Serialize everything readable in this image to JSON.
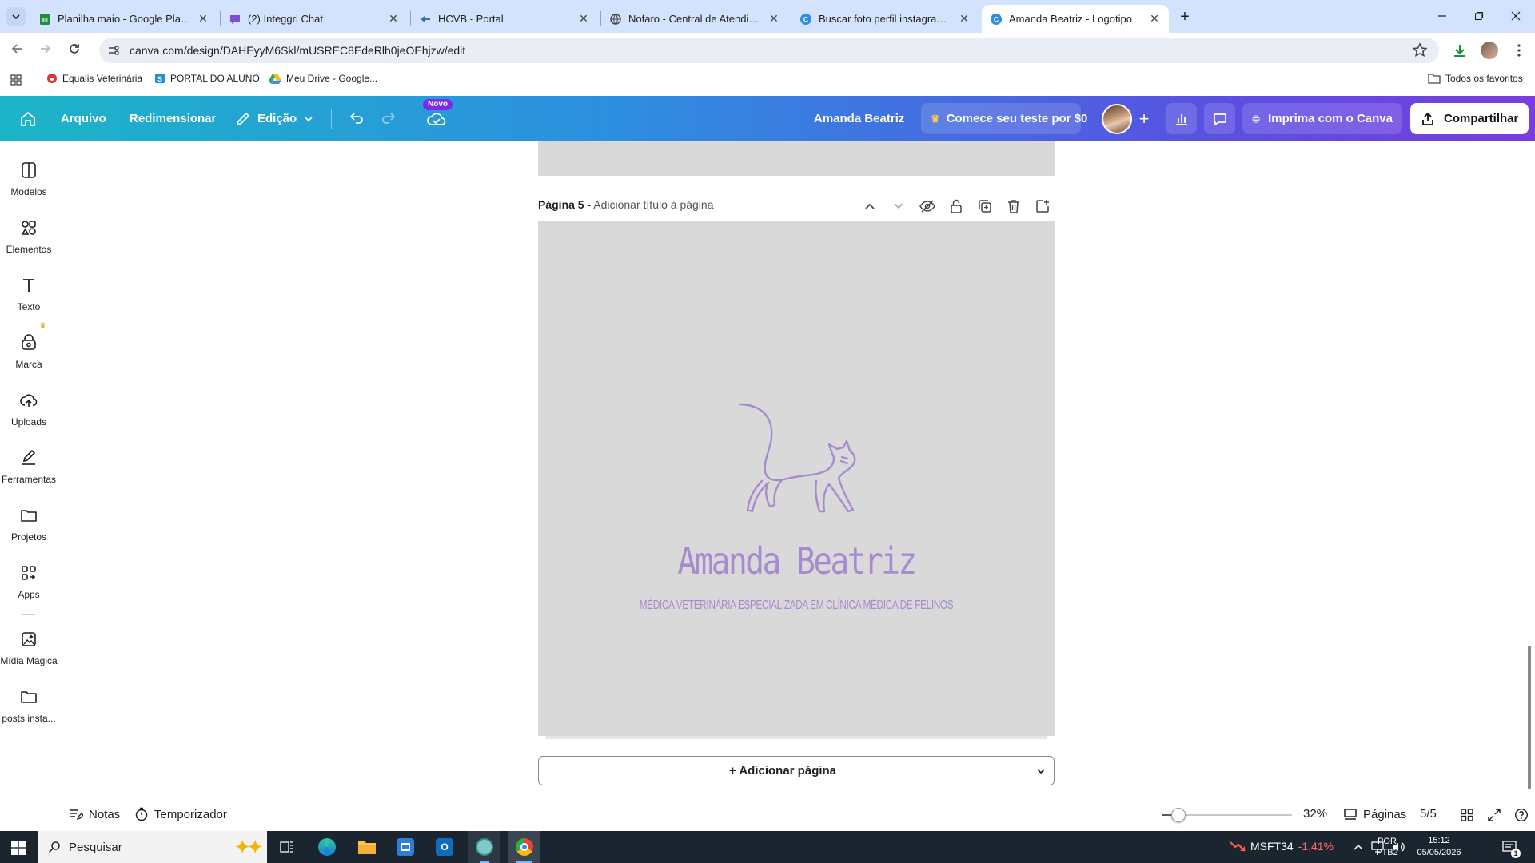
{
  "browser": {
    "tabs": [
      {
        "title": "Planilha maio - Google Planilhas",
        "icon": "sheets-icon"
      },
      {
        "title": "(2) Integgri Chat",
        "icon": "chat-icon"
      },
      {
        "title": "HCVB - Portal",
        "icon": "portal-icon"
      },
      {
        "title": "Nofaro - Central de Atendimento",
        "icon": "globe-icon"
      },
      {
        "title": "Buscar foto perfil instagram - Canva",
        "icon": "canva-icon"
      },
      {
        "title": "Amanda Beatriz - Logotipo",
        "icon": "canva-icon"
      }
    ],
    "url": "canva.com/design/DAHEyyM6Skl/mUSREC8EdeRlh0jeOEhjzw/edit",
    "bookmarks": [
      {
        "label": "Equalis Veterinária"
      },
      {
        "label": "PORTAL DO ALUNO"
      },
      {
        "label": "Meu Drive - Google..."
      }
    ],
    "all_bookmarks": "Todos os favoritos"
  },
  "canva": {
    "menu": {
      "file": "Arquivo",
      "resize": "Redimensionar",
      "edit": "Edição",
      "new_badge": "Novo"
    },
    "doc_title": "Amanda Beatriz",
    "trial": "Comece seu teste por $0",
    "print": "Imprima com o Canva",
    "share": "Compartilhar",
    "sidebar": [
      {
        "label": "Modelos"
      },
      {
        "label": "Elementos"
      },
      {
        "label": "Texto"
      },
      {
        "label": "Marca"
      },
      {
        "label": "Uploads"
      },
      {
        "label": "Ferramentas"
      },
      {
        "label": "Projetos"
      },
      {
        "label": "Apps"
      },
      {
        "label": "Mídia Mágica"
      },
      {
        "label": "posts insta..."
      }
    ],
    "page": {
      "label": "Página 5 -",
      "title_placeholder": "Adicionar título à página",
      "logo_name": "Amanda Beatriz",
      "logo_tagline": "MÉDICA VETERINÁRIA ESPECIALIZADA EM CLÍNICA MÉDICA DE FELINOS",
      "logo_color": "#a78bcf",
      "background": "#d9d9d9"
    },
    "add_page": "+ Adicionar página",
    "bottom": {
      "notes": "Notas",
      "timer": "Temporizador",
      "zoom": "32%",
      "zoom_level": 0.32,
      "pages_label": "Páginas",
      "pages_count": "5/5"
    }
  },
  "taskbar": {
    "search": "Pesquisar",
    "stock": "MSFT34",
    "stock_change": "-1,41%",
    "stock_change_color": "#ff6b6b",
    "lang1": "POR",
    "lang2": "PTB2",
    "time": "15:12",
    "date": "05/05/2026",
    "notif_count": "1"
  }
}
